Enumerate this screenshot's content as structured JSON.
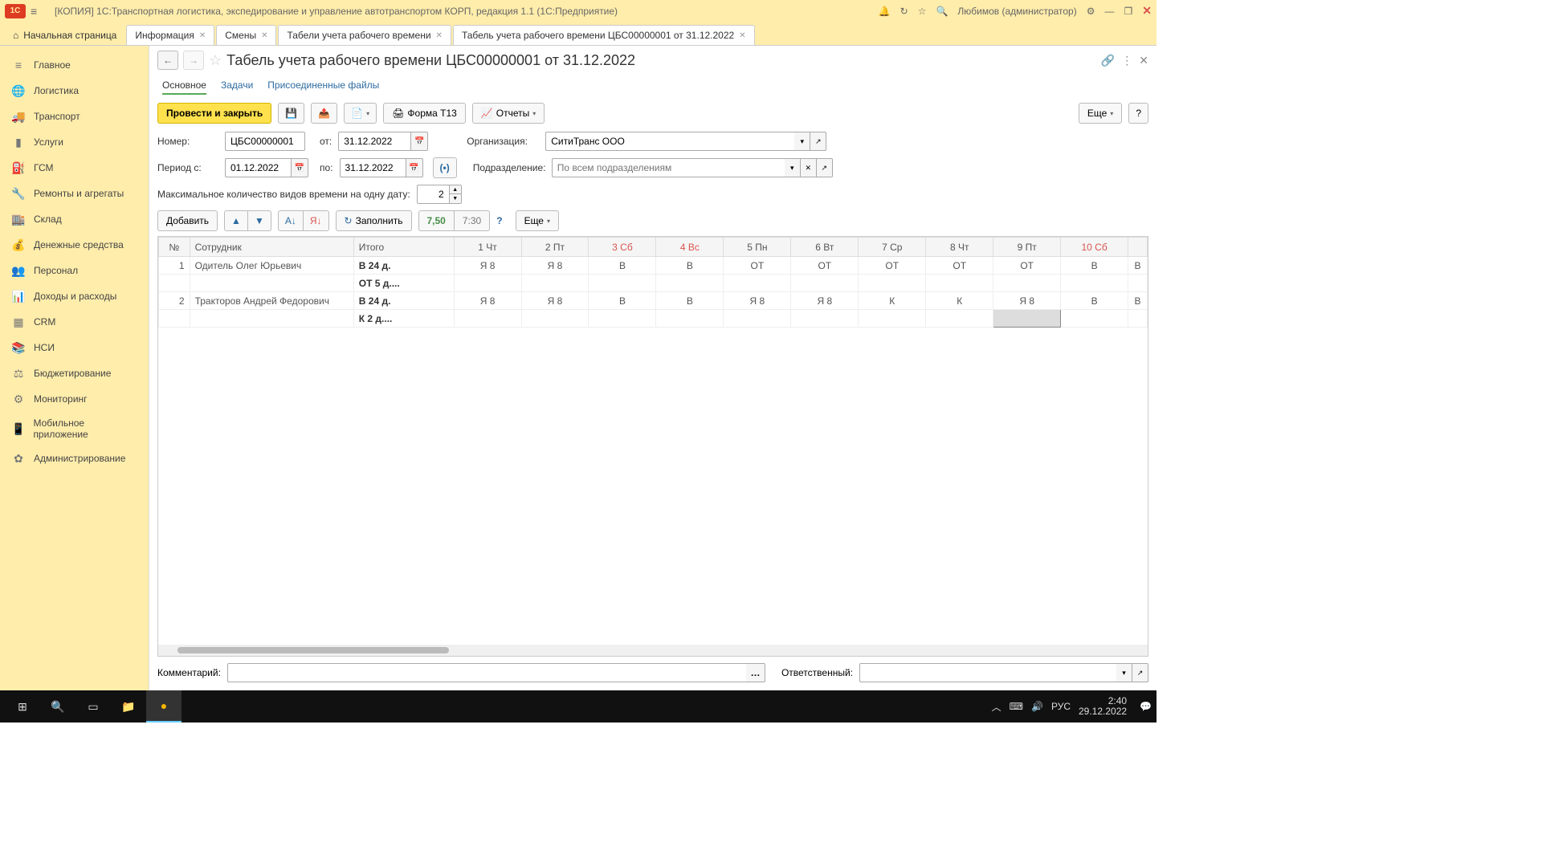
{
  "titlebar": {
    "logo": "1C",
    "text": "[КОПИЯ] 1С:Транспортная логистика, экспедирование и управление автотранспортом КОРП, редакция 1.1  (1С:Предприятие)",
    "user": "Любимов (администратор)"
  },
  "tabs": {
    "home": "Начальная страница",
    "items": [
      {
        "label": "Информация"
      },
      {
        "label": "Смены"
      },
      {
        "label": "Табели учета рабочего времени"
      },
      {
        "label": "Табель учета рабочего времени ЦБС00000001 от 31.12.2022"
      }
    ]
  },
  "sidebar": [
    {
      "icon": "≡",
      "label": "Главное"
    },
    {
      "icon": "🌐",
      "label": "Логистика"
    },
    {
      "icon": "🚚",
      "label": "Транспорт"
    },
    {
      "icon": "▮",
      "label": "Услуги"
    },
    {
      "icon": "⛽",
      "label": "ГСМ"
    },
    {
      "icon": "🔧",
      "label": "Ремонты и агрегаты"
    },
    {
      "icon": "🏬",
      "label": "Склад"
    },
    {
      "icon": "💰",
      "label": "Денежные средства"
    },
    {
      "icon": "👥",
      "label": "Персонал"
    },
    {
      "icon": "📊",
      "label": "Доходы и расходы"
    },
    {
      "icon": "▦",
      "label": "CRM"
    },
    {
      "icon": "📚",
      "label": "НСИ"
    },
    {
      "icon": "⚖",
      "label": "Бюджетирование"
    },
    {
      "icon": "⚙",
      "label": "Мониторинг"
    },
    {
      "icon": "📱",
      "label": "Мобильное приложение"
    },
    {
      "icon": "✿",
      "label": "Администрирование"
    }
  ],
  "page": {
    "title": "Табель учета рабочего времени ЦБС00000001 от 31.12.2022",
    "subtabs": [
      "Основное",
      "Задачи",
      "Присоединенные файлы"
    ],
    "toolbar": {
      "post_close": "Провести и закрыть",
      "form_t13": "Форма Т13",
      "reports": "Отчеты",
      "more": "Еще"
    },
    "form": {
      "number_label": "Номер:",
      "number": "ЦБС00000001",
      "from_label": "от:",
      "from_date": "31.12.2022",
      "org_label": "Организация:",
      "org": "СитиТранс ООО",
      "period_from_label": "Период с:",
      "period_from": "01.12.2022",
      "period_to_label": "по:",
      "period_to": "31.12.2022",
      "dept_label": "Подразделение:",
      "dept_placeholder": "По всем подразделениям",
      "max_types_label": "Максимальное количество видов времени на одну дату:",
      "max_types": "2"
    },
    "toolbar2": {
      "add": "Добавить",
      "fill": "Заполнить",
      "hours_dec": "7,50",
      "hours_hm": "7:30",
      "more": "Еще"
    },
    "grid": {
      "headers": {
        "num": "№",
        "emp": "Сотрудник",
        "total": "Итого",
        "days": [
          "1 Чт",
          "2 Пт",
          "3 Сб",
          "4 Вс",
          "5 Пн",
          "6 Вт",
          "7 Ср",
          "8 Чт",
          "9 Пт",
          "10 Сб"
        ]
      },
      "weekend_idx": [
        2,
        3,
        9
      ],
      "rows": [
        {
          "n": "1",
          "emp": "Одитель Олег Юрьевич",
          "total": "В 24 д.",
          "cells": [
            "Я 8",
            "Я 8",
            "В",
            "В",
            "ОТ",
            "ОТ",
            "ОТ",
            "ОТ",
            "ОТ",
            "В",
            "В"
          ],
          "sub": "ОТ 5 д...."
        },
        {
          "n": "2",
          "emp": "Тракторов Андрей Федорович",
          "total": "В 24 д.",
          "cells": [
            "Я 8",
            "Я 8",
            "В",
            "В",
            "Я 8",
            "Я 8",
            "К",
            "К",
            "Я 8",
            "В",
            "В"
          ],
          "sub": "К 2 д...."
        }
      ]
    },
    "footer": {
      "comment_label": "Комментарий:",
      "responsible_label": "Ответственный:"
    }
  },
  "taskbar": {
    "lang": "РУС",
    "time": "2:40",
    "date": "29.12.2022"
  }
}
